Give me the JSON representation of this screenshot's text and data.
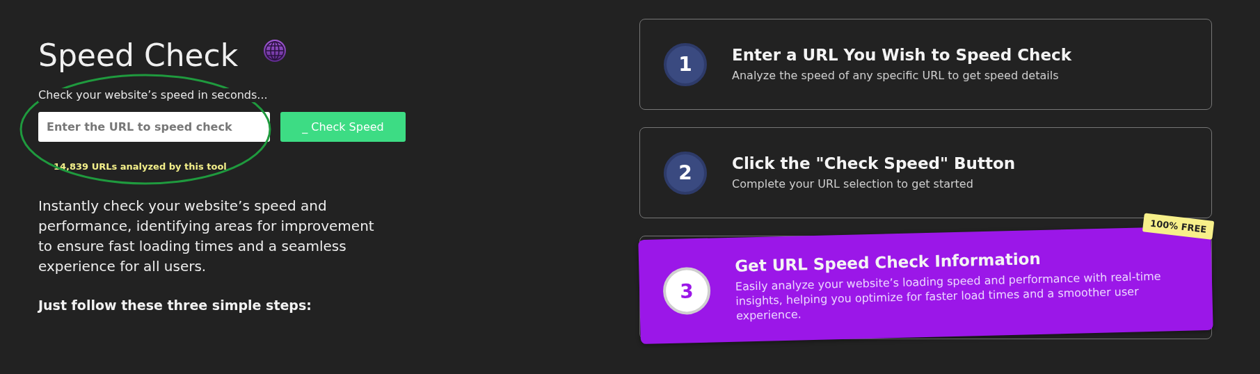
{
  "hero": {
    "title": "Speed Check",
    "subtitle": "Check your website’s speed in seconds...",
    "url_field": {
      "placeholder": "Enter the URL to speed check"
    },
    "check_button": "_ Check Speed",
    "analyzed_count": "14,839 URLs analyzed by this tool",
    "description": "Instantly check your website’s speed and performance, identifying areas for improvement to ensure fast loading times and a seamless experience for all users.",
    "steps_intro": "Just follow these three simple steps:"
  },
  "steps": [
    {
      "number": "1",
      "title": "Enter a URL You Wish to Speed Check",
      "text": "Analyze the speed of any specific URL to get speed details",
      "selected": false
    },
    {
      "number": "2",
      "title": "Click the \"Check Speed\" Button",
      "text": "Complete your URL selection to get started",
      "selected": false
    },
    {
      "number": "3",
      "title": "Get URL Speed Check Information",
      "text": "Easily analyze your website’s loading speed and performance with real-time insights, helping you optimize for faster load times and a smoother user experience.",
      "selected": true,
      "badge": "100% FREE"
    }
  ]
}
